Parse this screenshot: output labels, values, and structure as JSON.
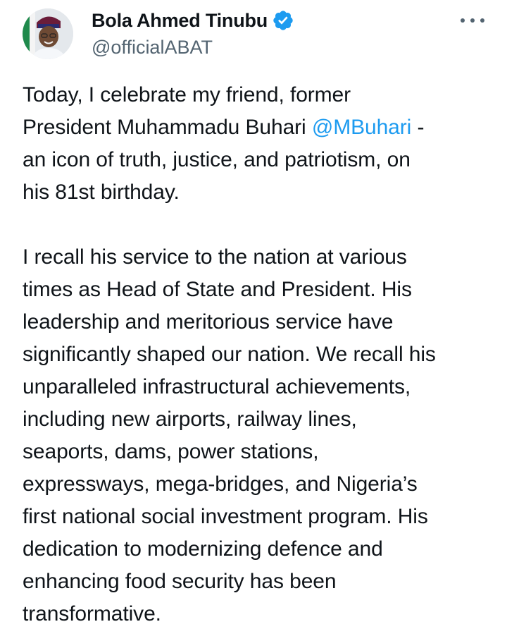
{
  "author": {
    "display_name": "Bola Ahmed Tinubu",
    "handle": "@officialABAT",
    "verified": true,
    "verified_color": "#1d9bf0"
  },
  "actions": {
    "more_icon": "more-horizontal-icon"
  },
  "tweet": {
    "paragraph_1": {
      "line_1": "Today, I celebrate my friend, former",
      "line_2_prefix": "President Muhammadu Buhari ",
      "mention": "@MBuhari",
      "line_2_suffix": " -",
      "line_3": "an icon of truth, justice, and patriotism, on",
      "line_4": "his 81st birthday."
    },
    "paragraph_2": {
      "lines": [
        "I recall his service to the nation at various",
        "times as Head of State and President. His",
        "leadership and meritorious service have",
        "significantly shaped our nation. We recall his",
        "unparalleled infrastructural achievements,",
        "including new airports, railway lines,",
        "seaports, dams, power stations,",
        "expressways, mega-bridges, and Nigeria’s",
        "first national social investment program. His",
        "dedication to modernizing defence and",
        "enhancing food security has been",
        "transformative."
      ]
    }
  },
  "colors": {
    "text": "#0f1419",
    "secondary": "#536471",
    "link": "#1d9bf0"
  }
}
